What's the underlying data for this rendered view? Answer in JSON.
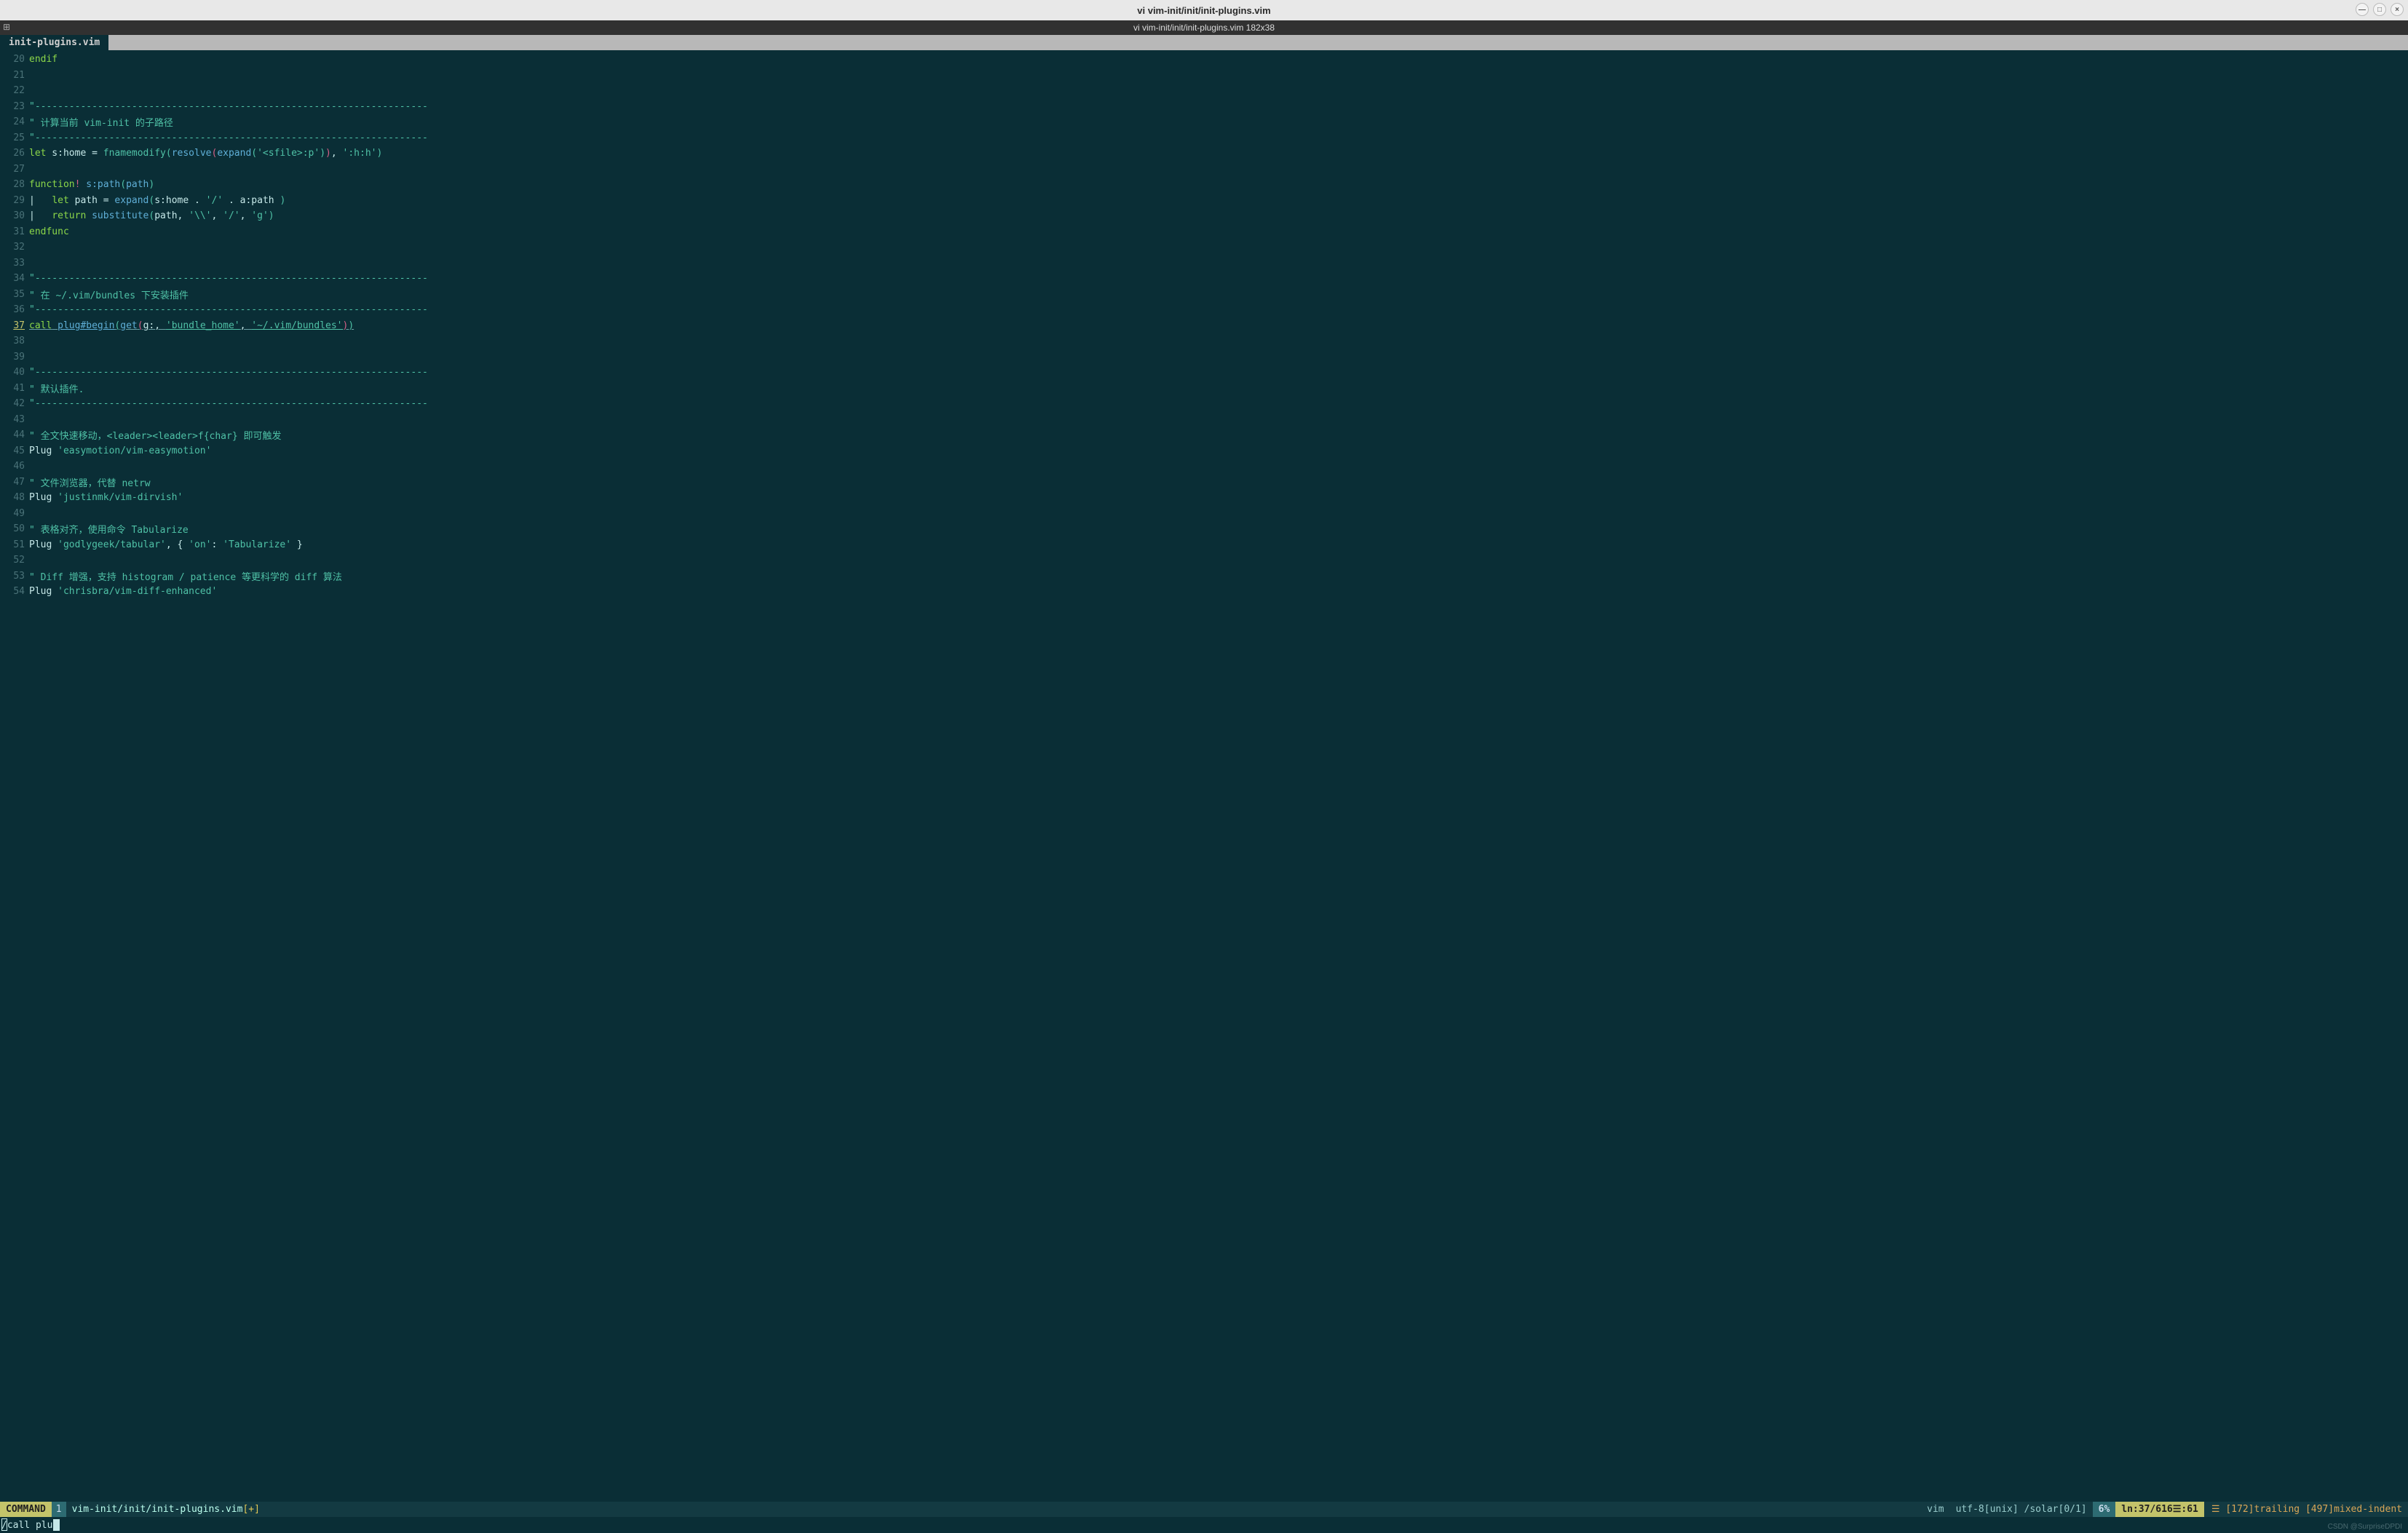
{
  "window": {
    "title": "vi vim-init/init/init-plugins.vim",
    "subtitle": "vi vim-init/init/init-plugins.vim 182x38",
    "minimize_glyph": "—",
    "maximize_glyph": "□",
    "close_glyph": "×",
    "corner_glyph": "⊞"
  },
  "tab": {
    "name": "init-plugins.vim"
  },
  "lines": {
    "n20": "20",
    "n21": "21",
    "n22": "22",
    "n23": "23",
    "n24": "24",
    "n25": "25",
    "n26": "26",
    "n27": "27",
    "n28": "28",
    "n29": "29",
    "n30": "30",
    "n31": "31",
    "n32": "32",
    "n33": "33",
    "n34": "34",
    "n35": "35",
    "n36": "36",
    "n37": "37",
    "n38": "38",
    "n39": "39",
    "n40": "40",
    "n41": "41",
    "n42": "42",
    "n43": "43",
    "n44": "44",
    "n45": "45",
    "n46": "46",
    "n47": "47",
    "n48": "48",
    "n49": "49",
    "n50": "50",
    "n51": "51",
    "n52": "52",
    "n53": "53",
    "n54": "54"
  },
  "code": {
    "l20_endif": "endif",
    "dashline": "\"---------------------------------------------------------------------",
    "l24_comment": "\" 计算当前 vim-init 的子路径",
    "l26_let": "let",
    "l26_var": " s:home ",
    "l26_eq": "= ",
    "l26_fn1": "fnamemodify",
    "l26_lp1": "(",
    "l26_fn2": "resolve",
    "l26_lp2": "(",
    "l26_fn3": "expand",
    "l26_lp3": "(",
    "l26_str1": "'<sfile>:p'",
    "l26_rp3": ")",
    "l26_rp2": ")",
    "l26_comma": ", ",
    "l26_str2": "':h:h'",
    "l26_rp1": ")",
    "l28_func": "function",
    "l28_bang": "!",
    "l28_name": " s:path",
    "l28_lp": "(",
    "l28_arg": "path",
    "l28_rp": ")",
    "l29_pipe": "|   ",
    "l29_let": "let",
    "l29_var": " path ",
    "l29_eq": "= ",
    "l29_fn": "expand",
    "l29_lp": "(",
    "l29_body": "s:home . ",
    "l29_str1": "'/'",
    "l29_dot": " . a:path ",
    "l29_rp": ")",
    "l30_pipe": "|   ",
    "l30_ret": "return",
    "l30_sp": " ",
    "l30_fn": "substitute",
    "l30_lp": "(",
    "l30_arg1": "path, ",
    "l30_str1": "'\\\\'",
    "l30_c1": ", ",
    "l30_str2": "'/'",
    "l30_c2": ", ",
    "l30_str3": "'g'",
    "l30_rp": ")",
    "l31_endfunc": "endfunc",
    "l35_comment": "\" 在 ~/.vim/bundles 下安装插件",
    "l37_call": "call",
    "l37_sp": " ",
    "l37_fn": "plug#begin",
    "l37_lp": "(",
    "l37_get": "get",
    "l37_lp2": "(",
    "l37_g": "g:, ",
    "l37_str1": "'bundle_home'",
    "l37_c": ", ",
    "l37_str2": "'~/.vim/bundles'",
    "l37_rp2": ")",
    "l37_rp": ")",
    "l41_comment": "\" 默认插件.",
    "l44_comment": "\" 全文快速移动，<leader><leader>f{char} 即可触发",
    "l45_plug": "Plug ",
    "l45_str": "'easymotion/vim-easymotion'",
    "l47_comment": "\" 文件浏览器，代替 netrw",
    "l48_plug": "Plug ",
    "l48_str": "'justinmk/vim-dirvish'",
    "l50_comment": "\" 表格对齐，使用命令 Tabularize",
    "l51_plug": "Plug ",
    "l51_str": "'godlygeek/tabular'",
    "l51_rest1": ", { ",
    "l51_key": "'on'",
    "l51_colon": ": ",
    "l51_val": "'Tabularize'",
    "l51_rest2": " }",
    "l53_comment": "\" Diff 增强，支持 histogram / patience 等更科学的 diff 算法",
    "l54_plug": "Plug ",
    "l54_str": "'chrisbra/vim-diff-enhanced'"
  },
  "status": {
    "mode": "COMMAND",
    "bufnum": "1",
    "file": "vim-init/init/init-plugins.vim",
    "modified": "[+]",
    "filetype": "vim",
    "encoding": "utf-8[unix]",
    "colorscheme": "/solar[0/1]",
    "percent": "6%",
    "pos_label": "ln:",
    "pos_line": "37",
    "pos_sep": "/",
    "pos_total": "616",
    "pos_glyph": "☰",
    "pos_col_sep": ":",
    "pos_col": "61",
    "warn_glyph": "☰",
    "warn_trailing": "[172]trailing",
    "warn_mixed": "[497]mixed-indent"
  },
  "cmdline": {
    "text": "/call plu"
  },
  "watermark": "CSDN @SurpriseDPDI"
}
